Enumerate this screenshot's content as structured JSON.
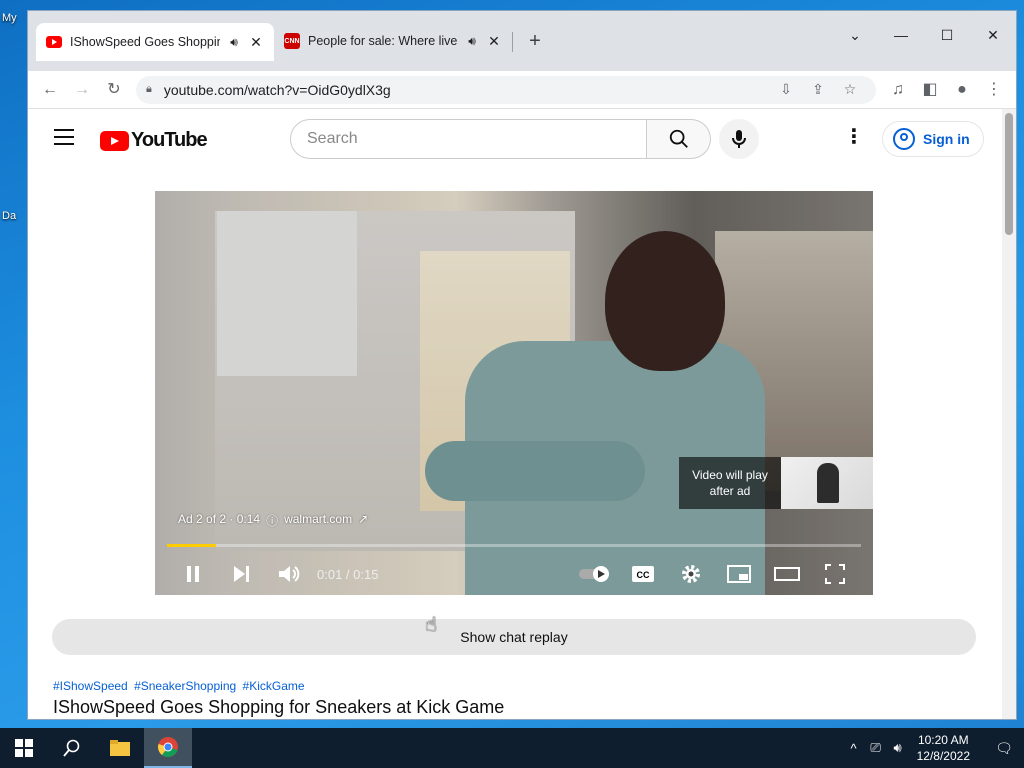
{
  "desktop": {
    "labels": [
      "My",
      "Da"
    ]
  },
  "browser": {
    "tabs": [
      {
        "title": "IShowSpeed Goes Shopping",
        "icon": "youtube-favicon",
        "audio": true,
        "active": true
      },
      {
        "title": "People for sale: Where lives a",
        "icon": "cnn-favicon",
        "favicon_text": "CNN",
        "audio": true,
        "active": false
      }
    ],
    "address": "youtube.com/watch?v=OidG0ydlX3g"
  },
  "youtube": {
    "logo_text": "YouTube",
    "search_placeholder": "Search",
    "sign_in": "Sign in",
    "player": {
      "ad_label": "Ad 2 of 2 · 0:14",
      "ad_domain": "walmart.com",
      "up_next": "Video will play after ad",
      "time": "0:01 / 0:15",
      "progress": 0.07
    },
    "chat_replay": "Show chat replay",
    "hashtags": [
      "#IShowSpeed",
      "#SneakerShopping",
      "#KickGame"
    ],
    "video_title": "IShowSpeed Goes Shopping for Sneakers at Kick Game"
  },
  "taskbar": {
    "time": "10:20 AM",
    "date": "12/8/2022"
  },
  "colors": {
    "youtube_red": "#ff0000",
    "link_blue": "#065fd4",
    "ad_progress": "#ffcc00"
  }
}
